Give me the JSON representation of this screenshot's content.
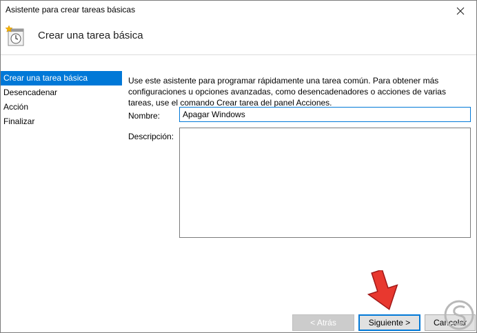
{
  "window": {
    "title": "Asistente para crear tareas básicas",
    "header_title": "Crear una tarea básica"
  },
  "nav": {
    "items": [
      {
        "label": "Crear una tarea básica",
        "active": true
      },
      {
        "label": "Desencadenar",
        "active": false
      },
      {
        "label": "Acción",
        "active": false
      },
      {
        "label": "Finalizar",
        "active": false
      }
    ]
  },
  "main": {
    "intro": "Use este asistente para programar rápidamente una tarea común. Para obtener más configuraciones u opciones avanzadas, como desencadenadores o acciones de varias tareas, use el comando Crear tarea del panel Acciones.",
    "name_label": "Nombre:",
    "name_value": "Apagar Windows",
    "description_label": "Descripción:",
    "description_value": ""
  },
  "buttons": {
    "back": "< Atrás",
    "next": "Siguiente >",
    "cancel": "Cancelar"
  },
  "colors": {
    "accent": "#0078d7",
    "arrow": "#e8382f"
  }
}
